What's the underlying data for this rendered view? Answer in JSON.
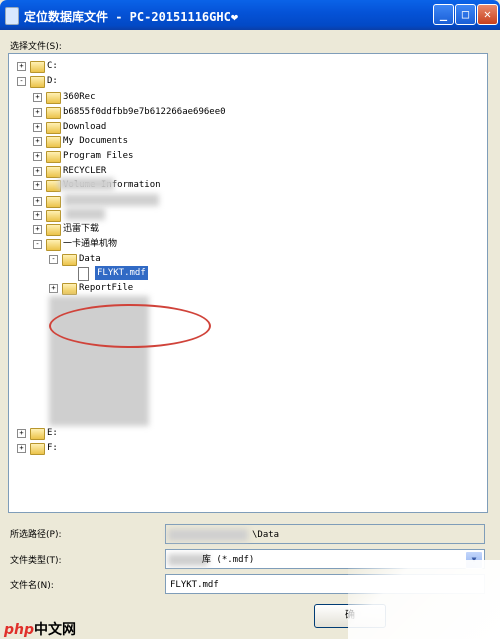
{
  "window": {
    "title": "定位数据库文件 - PC-20151116GHC❤",
    "minimize_glyph": "_",
    "maximize_glyph": "□",
    "close_glyph": "✕"
  },
  "select_file_label": "选择文件(S):",
  "tree": [
    {
      "label": "C:",
      "expander": "+",
      "icon": "folder-icon"
    },
    {
      "label": "D:",
      "expander": "-",
      "icon": "folder-icon"
    },
    {
      "label": "360Rec",
      "expander": "+",
      "icon": "folder-icon"
    },
    {
      "label": "b6855f0ddfbb9e7b612266ae696ee0",
      "expander": "+",
      "icon": "folder-icon"
    },
    {
      "label": "Download",
      "expander": "+",
      "icon": "folder-icon"
    },
    {
      "label": "My Documents",
      "expander": "+",
      "icon": "folder-icon"
    },
    {
      "label": "Program Files",
      "expander": "+",
      "icon": "folder-icon"
    },
    {
      "label": "RECYCLER",
      "expander": "+",
      "icon": "folder-icon"
    },
    {
      "label": "Volume Information",
      "expander": "+",
      "icon": "folder-icon"
    },
    {
      "label": "",
      "expander": "+",
      "icon": "folder-icon"
    },
    {
      "label": "",
      "expander": "+",
      "icon": "folder-icon"
    },
    {
      "label": "迅雷下载",
      "expander": "+",
      "icon": "folder-icon"
    },
    {
      "label": "一卡通单机物",
      "expander": "-",
      "icon": "folder-icon"
    },
    {
      "label": "Data",
      "expander": "-",
      "icon": "folder-icon"
    },
    {
      "label": "FLYKT.mdf",
      "expander": "",
      "icon": "file-icon",
      "selected": true
    },
    {
      "label": "ReportFile",
      "expander": "+",
      "icon": "folder-icon"
    },
    {
      "label": "E:",
      "expander": "+",
      "icon": "folder-icon"
    },
    {
      "label": "F:",
      "expander": "+",
      "icon": "folder-icon"
    }
  ],
  "selected_path": {
    "label": "所选路径(P):",
    "value": "\\Data"
  },
  "file_type": {
    "label": "文件类型(T):",
    "value": "库 (*.mdf)"
  },
  "file_name": {
    "label": "文件名(N):",
    "value": "FLYKT.mdf"
  },
  "ok_button": "确",
  "watermark": {
    "brand": "php",
    "text": "中文网"
  }
}
